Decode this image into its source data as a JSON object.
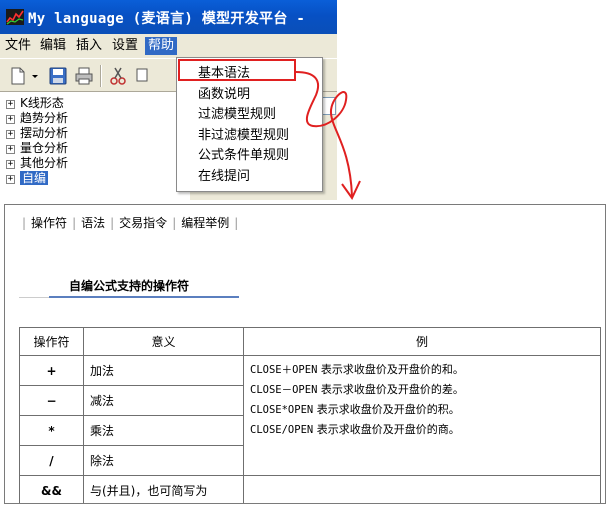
{
  "window": {
    "title": "My language (麦语言) 模型开发平台 -"
  },
  "menubar": {
    "items": [
      "文件",
      "编辑",
      "插入",
      "设置",
      "帮助"
    ]
  },
  "toolbar": {
    "icons": [
      "new-file-icon",
      "save-icon",
      "print-icon",
      "cut-icon",
      "copy-icon"
    ]
  },
  "help_menu": {
    "items": [
      "基本语法",
      "函数说明",
      "过滤模型规则",
      "非过滤模型规则",
      "公式条件单规则",
      "在线提问"
    ]
  },
  "tree": {
    "items": [
      "K线形态",
      "趋势分析",
      "摆动分析",
      "量仓分析",
      "其他分析",
      "自编"
    ],
    "expander": "⊞"
  },
  "doc": {
    "tabs": [
      "操作符",
      "语法",
      "交易指令",
      "编程举例"
    ],
    "tab_separator": "|",
    "section_title": "自编公式支持的操作符",
    "table": {
      "headers": [
        "操作符",
        "意义",
        "例"
      ],
      "rows": [
        {
          "symbol": "+",
          "meaning": "加法"
        },
        {
          "symbol": "−",
          "meaning": "减法"
        },
        {
          "symbol": "*",
          "meaning": "乘法"
        },
        {
          "symbol": "/",
          "meaning": "除法"
        },
        {
          "symbol": "&&",
          "meaning": "与(并且)，也可简写为"
        }
      ],
      "examples": [
        {
          "code": "CLOSE＋OPEN",
          "text": " 表示求收盘价及开盘价的和。"
        },
        {
          "code": "CLOSE－OPEN",
          "text": " 表示求收盘价及开盘价的差。"
        },
        {
          "code": "CLOSE*OPEN",
          "text": " 表示求收盘价及开盘价的积。"
        },
        {
          "code": "CLOSE/OPEN",
          "text": " 表示求收盘价及开盘价的商。"
        }
      ]
    }
  },
  "colors": {
    "menu_highlight": "#316ac5",
    "callout_red": "#e02020",
    "section_underline": "#5b7fbf"
  }
}
